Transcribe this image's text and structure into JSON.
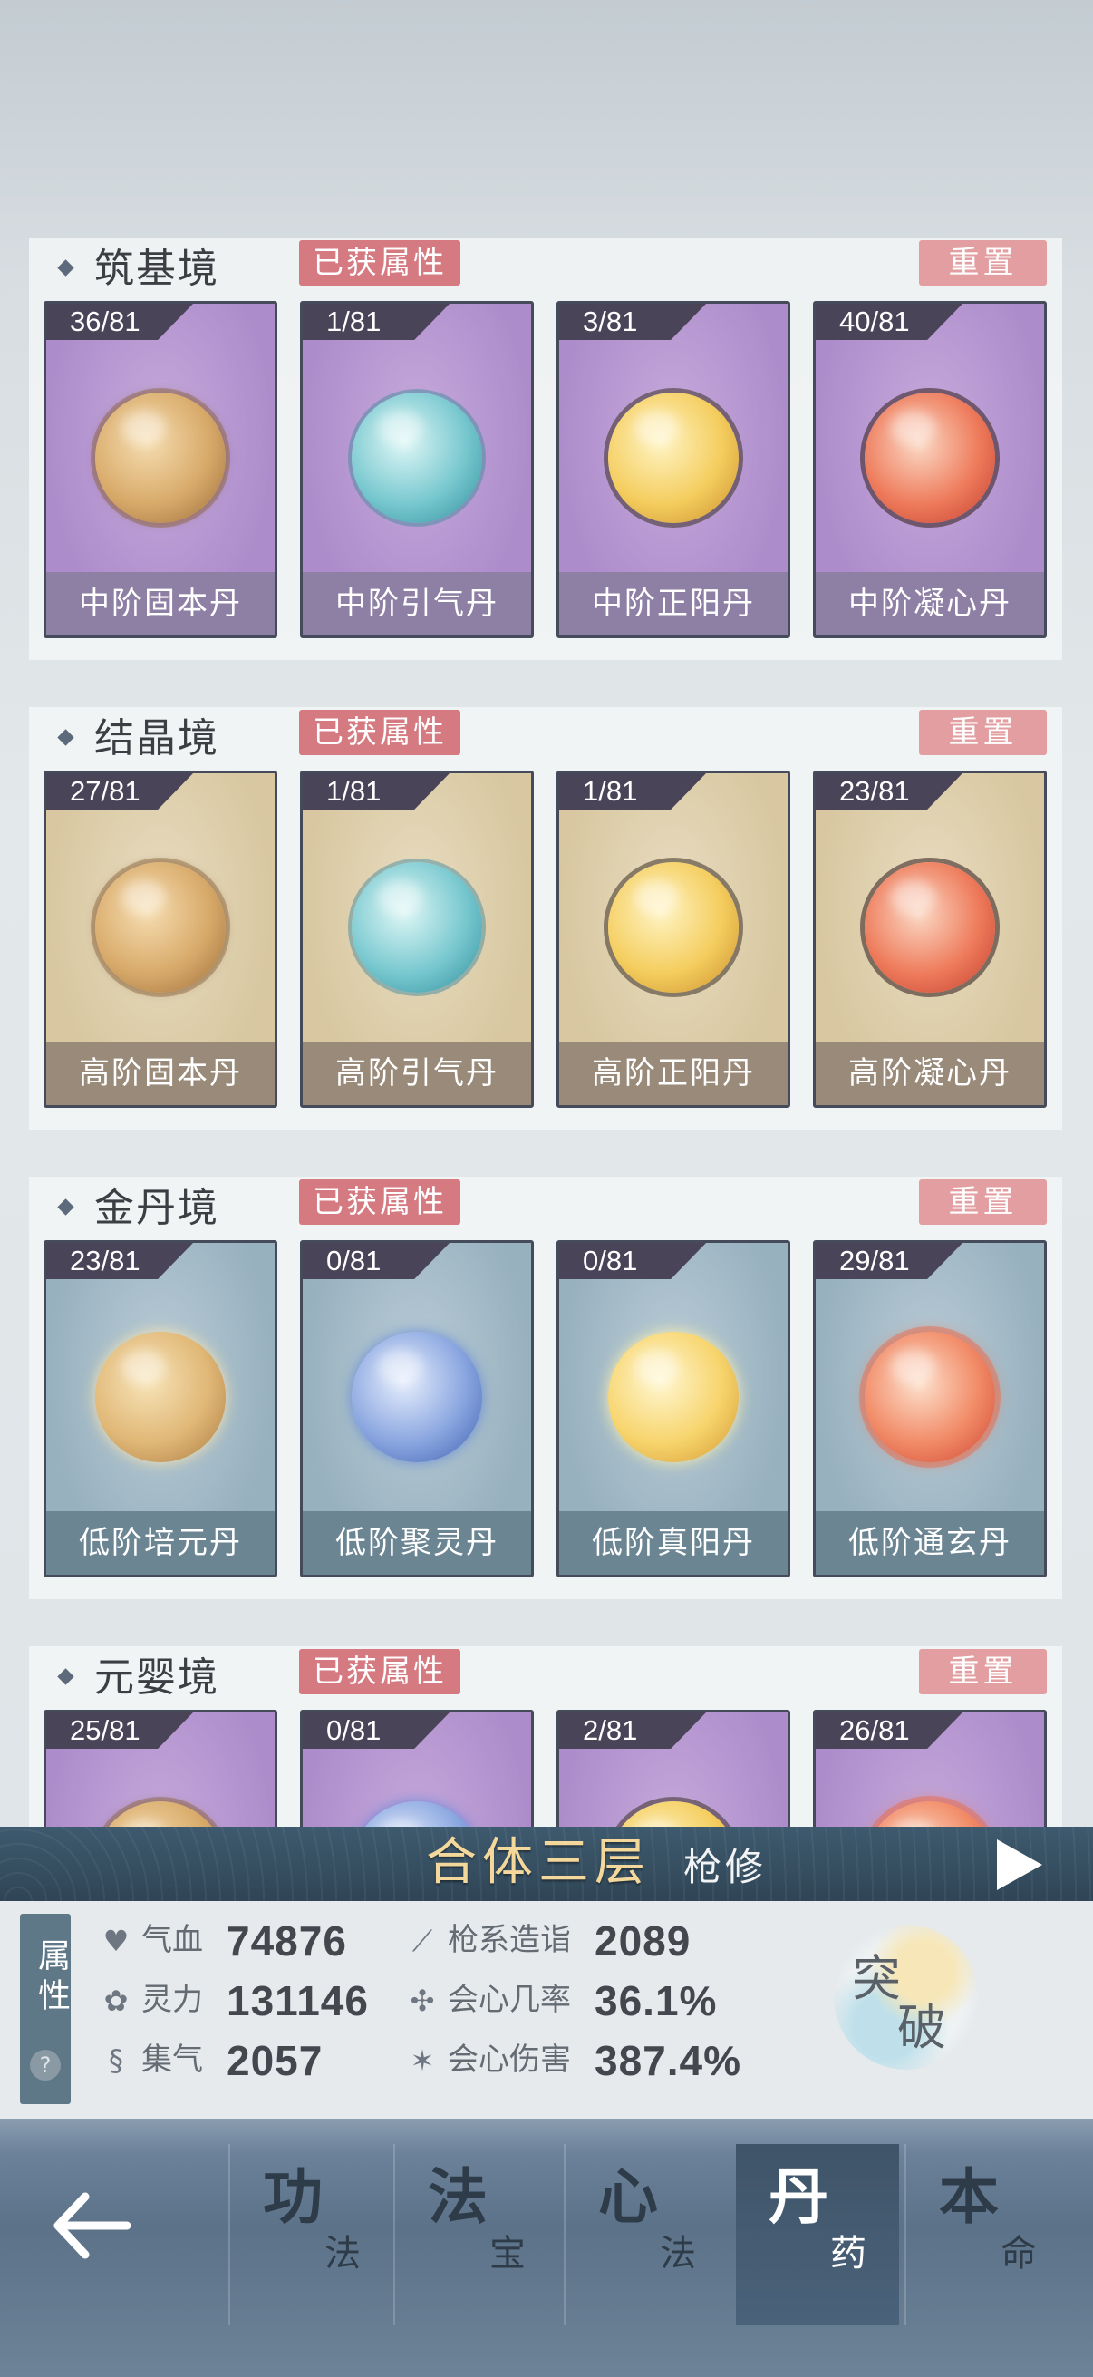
{
  "sections": [
    {
      "realm": "筑基境",
      "attr_button": "已获属性",
      "reset_button": "重置",
      "theme": "purple",
      "cards": [
        {
          "count": "36/81",
          "name": "中阶固本丹",
          "orb": "orb-bronze"
        },
        {
          "count": "1/81",
          "name": "中阶引气丹",
          "orb": "orb-cyan"
        },
        {
          "count": "3/81",
          "name": "中阶正阳丹",
          "orb": "orb-yellow"
        },
        {
          "count": "40/81",
          "name": "中阶凝心丹",
          "orb": "orb-red"
        }
      ]
    },
    {
      "realm": "结晶境",
      "attr_button": "已获属性",
      "reset_button": "重置",
      "theme": "gold",
      "cards": [
        {
          "count": "27/81",
          "name": "高阶固本丹",
          "orb": "orb-bronze"
        },
        {
          "count": "1/81",
          "name": "高阶引气丹",
          "orb": "orb-cyan"
        },
        {
          "count": "1/81",
          "name": "高阶正阳丹",
          "orb": "orb-yellow"
        },
        {
          "count": "23/81",
          "name": "高阶凝心丹",
          "orb": "orb-red"
        }
      ]
    },
    {
      "realm": "金丹境",
      "attr_button": "已获属性",
      "reset_button": "重置",
      "theme": "blue",
      "cards": [
        {
          "count": "23/81",
          "name": "低阶培元丹",
          "orb": "orb-glow-bronze"
        },
        {
          "count": "0/81",
          "name": "低阶聚灵丹",
          "orb": "orb-bluestar"
        },
        {
          "count": "0/81",
          "name": "低阶真阳丹",
          "orb": "orb-glow-yellow"
        },
        {
          "count": "29/81",
          "name": "低阶通玄丹",
          "orb": "orb-glow-red"
        }
      ]
    },
    {
      "realm": "元婴境",
      "attr_button": "已获属性",
      "reset_button": "重置",
      "theme": "purple",
      "cards": [
        {
          "count": "25/81",
          "name": "",
          "orb": "orb-bronze"
        },
        {
          "count": "0/81",
          "name": "",
          "orb": "orb-bluestar"
        },
        {
          "count": "2/81",
          "name": "",
          "orb": "orb-yellow"
        },
        {
          "count": "26/81",
          "name": "",
          "orb": "orb-glow-red"
        }
      ]
    }
  ],
  "realm_bar": {
    "title": "合体三层",
    "subtitle": "枪修"
  },
  "stats": {
    "tab_label": "属性",
    "help": "?",
    "items": [
      {
        "icon": "heart-icon",
        "glyph": "♥",
        "label": "气血",
        "value": "74876"
      },
      {
        "icon": "spirit-drop-icon",
        "glyph": "✿",
        "label": "灵力",
        "value": "131146"
      },
      {
        "icon": "swirl-icon",
        "glyph": "§",
        "label": "集气",
        "value": "2057"
      },
      {
        "icon": "spear-icon",
        "glyph": "⟋",
        "label": "枪系造诣",
        "value": "2089"
      },
      {
        "icon": "crit-rate-icon",
        "glyph": "✣",
        "label": "会心几率",
        "value": "36.1%"
      },
      {
        "icon": "crit-damage-icon",
        "glyph": "✶",
        "label": "会心伤害",
        "value": "387.4%"
      }
    ],
    "breakthrough": [
      "突",
      "破"
    ]
  },
  "nav": {
    "tabs": [
      {
        "big": "功",
        "small": "法",
        "active": false
      },
      {
        "big": "法",
        "small": "宝",
        "active": false
      },
      {
        "big": "心",
        "small": "法",
        "active": false
      },
      {
        "big": "丹",
        "small": "药",
        "active": true
      },
      {
        "big": "本",
        "small": "命",
        "active": false
      }
    ]
  },
  "colors": {
    "attr_button": "#d47a80",
    "reset_button": "#e29ea0",
    "realm_title": "#f4d79a",
    "active_tab": "#3f5468"
  }
}
